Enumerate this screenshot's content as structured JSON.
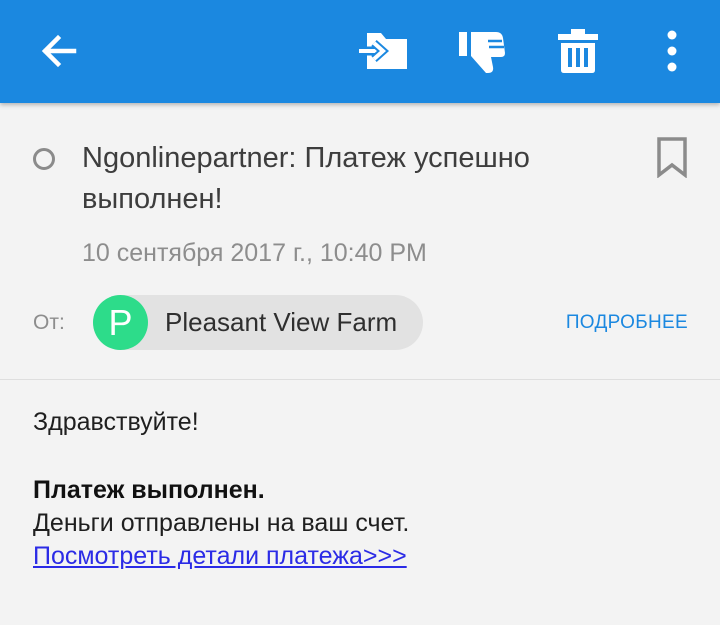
{
  "toolbar": {
    "icons": {
      "back": "arrow-left-icon",
      "move": "move-to-folder-icon",
      "spam": "thumbs-down-icon",
      "delete": "trash-icon",
      "more": "more-vertical-icon"
    },
    "background_color": "#1b88e0"
  },
  "message": {
    "subject": "Ngonlinepartner: Платеж успешно выполнен!",
    "date": "10 сентября 2017 г., 10:40 PM",
    "from_label": "От:",
    "sender": {
      "initial": "P",
      "name": "Pleasant View Farm",
      "avatar_color": "#2ddc8a"
    },
    "details_label": "ПОДРОБНЕЕ"
  },
  "body": {
    "greeting": "Здравствуйте!",
    "bold_line": "Платеж выполнен.",
    "text_line": "Деньги отправлены на ваш счет.",
    "link_text": "Посмотреть детали платежа>>>"
  }
}
